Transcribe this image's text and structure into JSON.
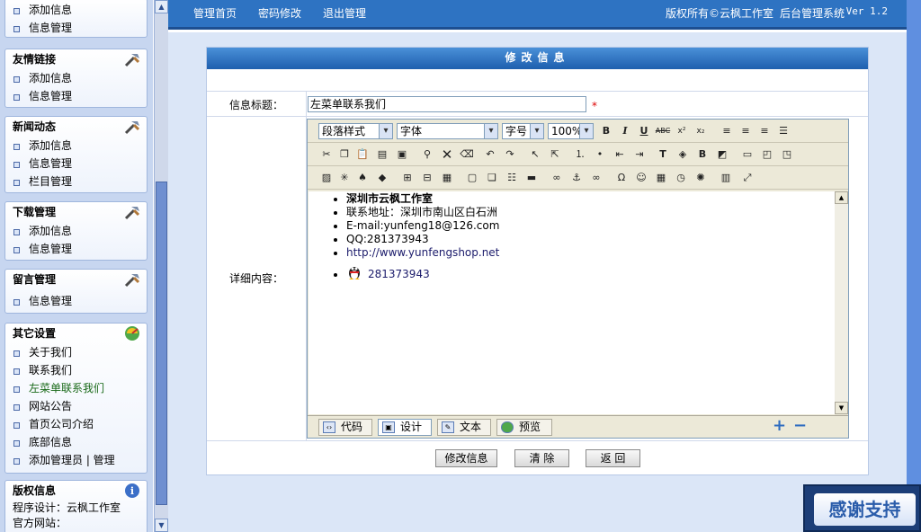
{
  "sidebar": {
    "box0": {
      "items": [
        "添加信息",
        "信息管理"
      ]
    },
    "box1": {
      "title": "友情链接",
      "items": [
        "添加信息",
        "信息管理"
      ]
    },
    "box2": {
      "title": "新闻动态",
      "items": [
        "添加信息",
        "信息管理",
        "栏目管理"
      ]
    },
    "box3": {
      "title": "下载管理",
      "items": [
        "添加信息",
        "信息管理"
      ]
    },
    "box4": {
      "title": "留言管理",
      "items": [
        "信息管理"
      ]
    },
    "box5": {
      "title": "其它设置",
      "items": [
        "关于我们",
        "联系我们",
        "左菜单联系我们",
        "网站公告",
        "首页公司介绍",
        "底部信息",
        "添加管理员 | 管理"
      ]
    },
    "box6": {
      "title": "版权信息",
      "lines": [
        "程序设计：云枫工作室",
        "官方网站："
      ]
    }
  },
  "topbar": {
    "home": "管理首页",
    "password": "密码修改",
    "logout": "退出管理",
    "copyright": "版权所有©云枫工作室",
    "system": "后台管理系统",
    "version": "Ver 1.2"
  },
  "panel": {
    "title": "修改信息",
    "title_label": "信息标题：",
    "title_value": "左菜单联系我们",
    "required_mark": "*",
    "content_label": "详细内容："
  },
  "editor": {
    "selects": {
      "paragraph": "段落样式",
      "font": "字体",
      "size": "字号",
      "zoom": "100%"
    },
    "content": {
      "company": "深圳市云枫工作室",
      "address": "联系地址：深圳市南山区白石洲",
      "email": "E-mail:yunfeng18@126.com",
      "qq": "QQ:281373943",
      "site": "http://www.yunfengshop.net",
      "qq_link": "281373943"
    },
    "modes": {
      "code": "代码",
      "design": "设计",
      "text": "文本",
      "preview": "预览"
    }
  },
  "buttons": {
    "submit": "修改信息",
    "clear": "清 除",
    "back": "返 回"
  },
  "badge": {
    "text": "感谢支持"
  }
}
